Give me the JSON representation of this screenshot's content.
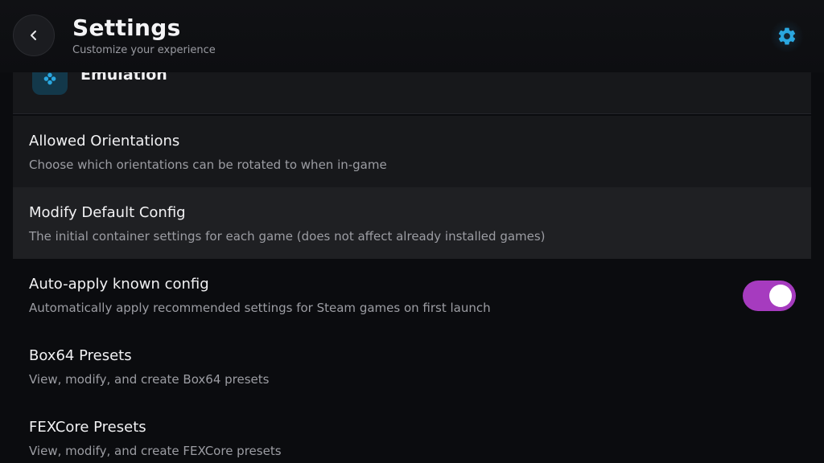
{
  "header": {
    "title": "Settings",
    "subtitle": "Customize your experience",
    "back_icon": "chevron-left-icon",
    "settings_icon": "gear-icon"
  },
  "section": {
    "title": "Emulation",
    "icon": "gamepad-icon",
    "icon_color": "#2aa7e0"
  },
  "rows": [
    {
      "title": "Allowed Orientations",
      "description": "Choose which orientations can be rotated to when in-game"
    },
    {
      "title": "Modify Default Config",
      "description": "The initial container settings for each game (does not affect already installed games)"
    },
    {
      "title": "Auto-apply known config",
      "description": "Automatically apply recommended settings for Steam games on first launch",
      "toggle_on": true
    },
    {
      "title": "Box64 Presets",
      "description": "View, modify, and create Box64 presets"
    },
    {
      "title": "FEXCore Presets",
      "description": "View, modify, and create FEXCore presets"
    }
  ],
  "colors": {
    "accent_toggle": "#a63bbf",
    "accent_blue": "#2aa7e0",
    "background": "#0b0c0f"
  }
}
